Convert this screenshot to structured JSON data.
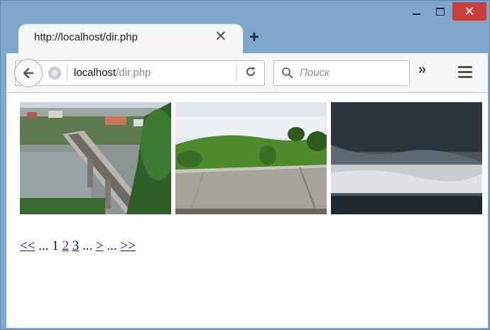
{
  "tab": {
    "title": "http://localhost/dir.php",
    "close_glyph": "✕",
    "new_tab_glyph": "+"
  },
  "window": {
    "close_glyph": "✕"
  },
  "toolbar": {
    "url_host": "localhost",
    "url_path": "/dir.php",
    "reload_glyph": "C",
    "search_placeholder": "Поиск",
    "overflow_glyph": "»"
  },
  "images": [
    {
      "alt": "bridge-over-river-photo"
    },
    {
      "alt": "green-hill-and-concrete-photo"
    },
    {
      "alt": "stormy-sky-over-plain-photo"
    }
  ],
  "pagination": {
    "first": "<<",
    "ellipsis1": "...",
    "current": "1",
    "page2": "2",
    "page3": "3",
    "ellipsis2": "...",
    "next": ">",
    "ellipsis3": "...",
    "last": ">>"
  },
  "colors": {
    "frame": "#7fa7cd",
    "close": "#c9403a",
    "link": "#0000ee",
    "visited": "#551a8b"
  }
}
